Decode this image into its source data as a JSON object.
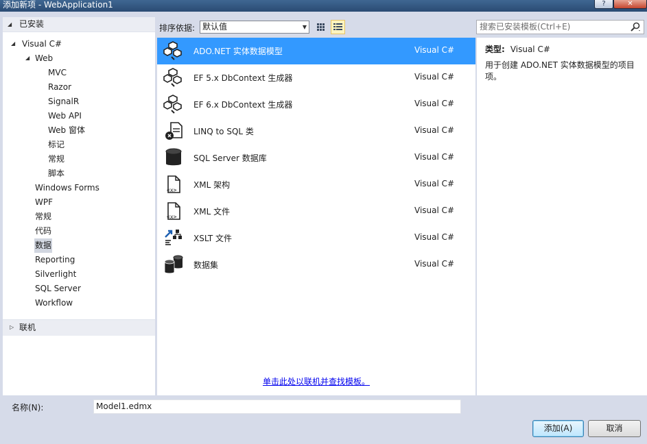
{
  "window": {
    "title": "添加新项 - WebApplication1",
    "help_label": "?",
    "close_label": "✕"
  },
  "tree": {
    "installed_header": "已安装",
    "root": "Visual C#",
    "web": "Web",
    "web_children": [
      "MVC",
      "Razor",
      "SignalR",
      "Web API",
      "Web 窗体",
      "标记",
      "常规",
      "脚本"
    ],
    "siblings": [
      "Windows Forms",
      "WPF",
      "常规",
      "代码",
      "数据",
      "Reporting",
      "Silverlight",
      "SQL Server",
      "Workflow"
    ],
    "selected": "数据",
    "online_header": "联机"
  },
  "toolbar": {
    "sort_label": "排序依据:",
    "sort_value": "默认值",
    "search_placeholder": "搜索已安装模板(Ctrl+E)"
  },
  "templates": [
    {
      "name": "ADO.NET 实体数据模型",
      "lang": "Visual C#",
      "icon": "entity-model-icon",
      "selected": true
    },
    {
      "name": "EF 5.x DbContext 生成器",
      "lang": "Visual C#",
      "icon": "entity-model-icon"
    },
    {
      "name": "EF 6.x DbContext 生成器",
      "lang": "Visual C#",
      "icon": "entity-model-icon"
    },
    {
      "name": "LINQ to SQL 类",
      "lang": "Visual C#",
      "icon": "linq-classes-icon"
    },
    {
      "name": "SQL Server 数据库",
      "lang": "Visual C#",
      "icon": "database-icon"
    },
    {
      "name": "XML 架构",
      "lang": "Visual C#",
      "icon": "xml-schema-icon"
    },
    {
      "name": "XML 文件",
      "lang": "Visual C#",
      "icon": "xml-file-icon"
    },
    {
      "name": "XSLT 文件",
      "lang": "Visual C#",
      "icon": "xslt-icon"
    },
    {
      "name": "数据集",
      "lang": "Visual C#",
      "icon": "dataset-icon"
    }
  ],
  "online_link": "单击此处以联机并查找模板。",
  "details": {
    "type_label": "类型:",
    "type_value": "Visual C#",
    "description": "用于创建 ADO.NET 实体数据模型的项目项。"
  },
  "footer": {
    "name_label": "名称(N):",
    "name_value": "Model1.edmx",
    "add_label": "添加(A)",
    "cancel_label": "取消"
  },
  "colors": {
    "selection": "#3399ff",
    "title_bar": "#2b4a6e",
    "dialog_bg": "#d6dbe9"
  }
}
